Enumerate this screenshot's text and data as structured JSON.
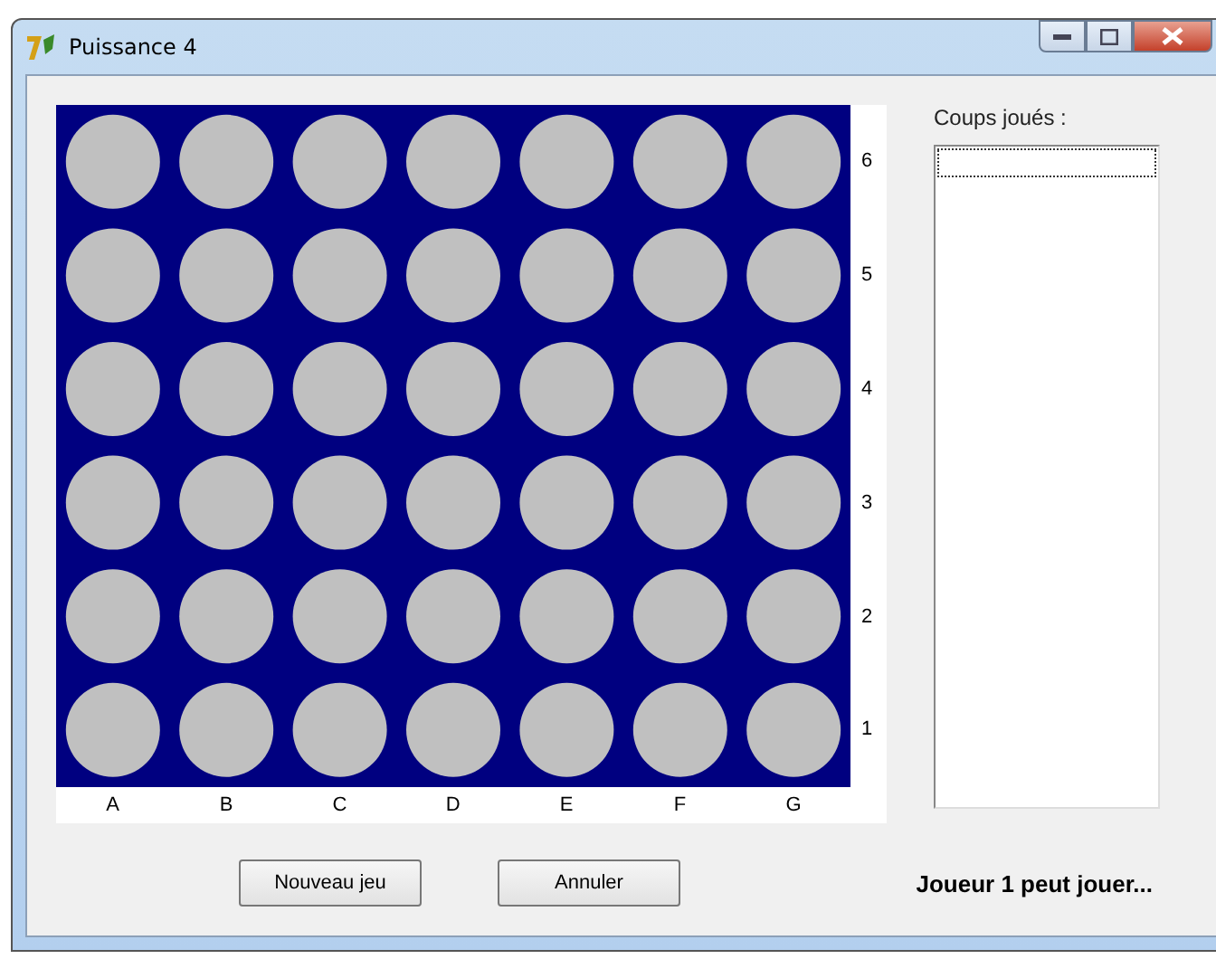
{
  "window": {
    "title": "Puissance 4"
  },
  "board": {
    "row_labels": [
      "6",
      "5",
      "4",
      "3",
      "2",
      "1"
    ],
    "column_labels": [
      "A",
      "B",
      "C",
      "D",
      "E",
      "F",
      "G"
    ],
    "rows": [
      {
        "slots": [
          {
            "kind": "empty"
          },
          {
            "kind": "empty"
          },
          {
            "kind": "empty"
          },
          {
            "kind": "empty"
          },
          {
            "kind": "empty"
          },
          {
            "kind": "empty"
          },
          {
            "kind": "empty"
          }
        ]
      },
      {
        "slots": [
          {
            "kind": "empty"
          },
          {
            "kind": "empty"
          },
          {
            "kind": "empty"
          },
          {
            "kind": "empty"
          },
          {
            "kind": "empty"
          },
          {
            "kind": "empty"
          },
          {
            "kind": "empty"
          }
        ]
      },
      {
        "slots": [
          {
            "kind": "empty"
          },
          {
            "kind": "empty"
          },
          {
            "kind": "empty"
          },
          {
            "kind": "empty"
          },
          {
            "kind": "empty"
          },
          {
            "kind": "empty"
          },
          {
            "kind": "empty"
          }
        ]
      },
      {
        "slots": [
          {
            "kind": "empty"
          },
          {
            "kind": "empty"
          },
          {
            "kind": "empty"
          },
          {
            "kind": "empty"
          },
          {
            "kind": "empty"
          },
          {
            "kind": "empty"
          },
          {
            "kind": "empty"
          }
        ]
      },
      {
        "slots": [
          {
            "kind": "empty"
          },
          {
            "kind": "empty"
          },
          {
            "kind": "empty"
          },
          {
            "kind": "empty"
          },
          {
            "kind": "empty"
          },
          {
            "kind": "empty"
          },
          {
            "kind": "empty"
          }
        ]
      },
      {
        "slots": [
          {
            "kind": "empty"
          },
          {
            "kind": "empty"
          },
          {
            "kind": "empty"
          },
          {
            "kind": "empty"
          },
          {
            "kind": "empty"
          },
          {
            "kind": "empty"
          },
          {
            "kind": "empty"
          }
        ]
      }
    ]
  },
  "moves": {
    "label": "Coups joués :"
  },
  "buttons": [
    "Nouveau jeu",
    "Annuler"
  ],
  "status": "Joueur 1 peut jouer..."
}
